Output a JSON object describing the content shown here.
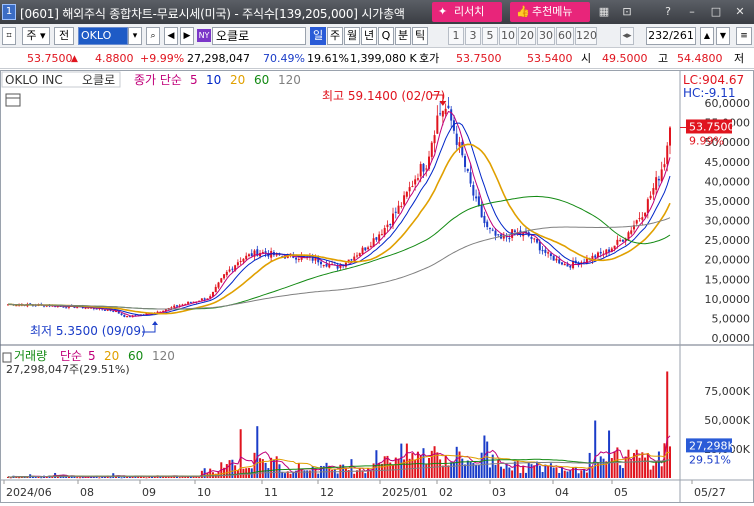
{
  "window": {
    "number": "1",
    "title": "[0601] 해외주식 종합차트-무료시세(미국) - 주식수[139,205,000]  시가총액",
    "research_label": "리서치",
    "recommend_label": "추천메뉴",
    "icons": [
      "split-icon",
      "resize-icon",
      "help-icon",
      "minimize-icon",
      "maximize-icon",
      "close-icon"
    ]
  },
  "toolbar": {
    "type_label": "주",
    "all_label": "전",
    "code": "OKLO",
    "exchange_badge": "NY",
    "stock_name": "오클로",
    "periods": [
      "일",
      "주",
      "월",
      "년",
      "Q",
      "분",
      "틱"
    ],
    "active_period": "일",
    "minute_options": [
      "1",
      "3",
      "5",
      "10",
      "20",
      "30",
      "60",
      "120"
    ],
    "pager": "232/261"
  },
  "quote": {
    "price": "53.7500",
    "change": "4.8800",
    "change_pct": "+9.99%",
    "volume": "27,298,047",
    "vol_ratio": "70.49%",
    "turnover": "19.61%",
    "amount": "1,399,080 K",
    "ask_label": "호가",
    "ask1": "53.7500",
    "ask2": "53.5400",
    "open_label": "시",
    "open": "49.5000",
    "high_label": "고",
    "high": "54.4800",
    "low_label": "저"
  },
  "price_panel": {
    "legend_name": "OKLO INC",
    "legend_kor": "오클로",
    "ma_label": "종가 단순",
    "ma_periods": [
      "5",
      "10",
      "20",
      "60",
      "120"
    ],
    "ma_colors": [
      "#c0007a",
      "#0026c8",
      "#e0a000",
      "#138a13",
      "#808080"
    ],
    "lc_label": "LC:904.67",
    "hc_label": "HC:-9.11",
    "current_price_label": "53.7500",
    "current_pct_label": "9.99%",
    "high_annotation": "최고 59.1400 (02/07)",
    "low_annotation": "최저 5.3500 (09/09)",
    "y_ticks": [
      "60,0000",
      "55,0000",
      "50,0000",
      "45,0000",
      "40,0000",
      "35,0000",
      "30,0000",
      "25,0000",
      "20,0000",
      "15,0000",
      "10,0000",
      "5,0000",
      "0,0000"
    ]
  },
  "volume_panel": {
    "label": "거래량",
    "ma_label": "단순",
    "ma_periods": [
      "5",
      "20",
      "60",
      "120"
    ],
    "ma_colors": [
      "#c0007a",
      "#e0a000",
      "#138a13",
      "#808080"
    ],
    "current_volume": "27,298,047주(29.51%)",
    "current_badge": "27,298K",
    "current_pct": "29.51%",
    "y_ticks": [
      "75,000K",
      "50,000K",
      "25,000K"
    ]
  },
  "x_axis": [
    "2024/06",
    "08",
    "09",
    "10",
    "11",
    "12",
    "2025/01",
    "02",
    "03",
    "04",
    "05",
    "05/27"
  ]
}
